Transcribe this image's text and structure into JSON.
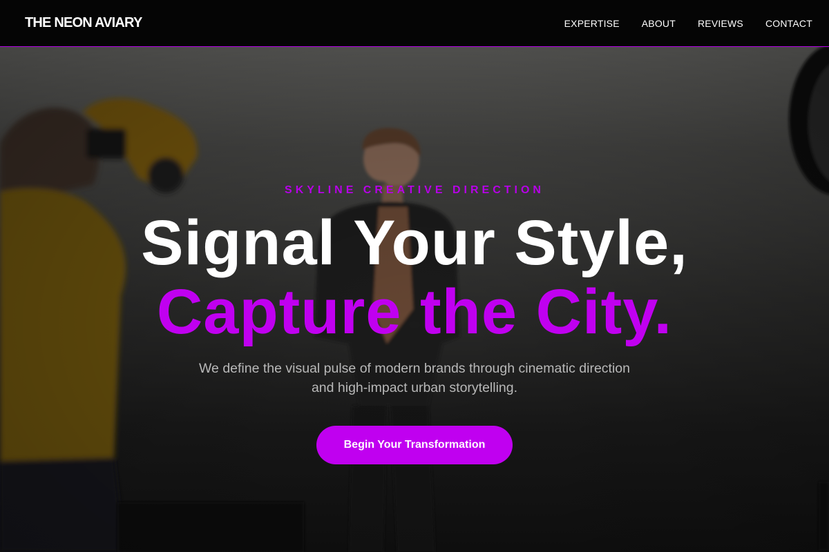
{
  "nav": {
    "brand": "THE NEON AVIARY",
    "items": [
      {
        "label": "EXPERTISE"
      },
      {
        "label": "ABOUT"
      },
      {
        "label": "REVIEWS"
      },
      {
        "label": "CONTACT"
      }
    ]
  },
  "hero": {
    "kicker": "SKYLINE CREATIVE DIRECTION",
    "headline_line1": "Signal Your Style,",
    "headline_line2": "Capture the City.",
    "description": "We define the visual pulse of modern brands through cinematic direction and high-impact urban storytelling.",
    "cta_label": "Begin Your Transformation"
  },
  "colors": {
    "accent": "#c000f0",
    "nav_background": "#050505",
    "text": "#ffffff",
    "muted_text": "#b8b8b8"
  }
}
